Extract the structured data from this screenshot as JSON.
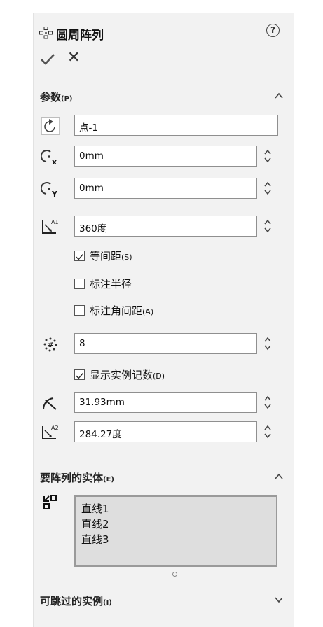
{
  "header": {
    "title": "圆周阵列",
    "help": "?"
  },
  "sections": {
    "params": {
      "label": "参数",
      "hotkey": "(P)",
      "axis_value": "点-1",
      "x_value": "0mm",
      "y_value": "0mm",
      "angle_value": "360度",
      "equal_spacing": {
        "label": "等间距",
        "hotkey": "(S)",
        "checked": true
      },
      "dim_radius": {
        "label": "标注半径",
        "checked": false
      },
      "dim_angle": {
        "label": "标注角间距",
        "hotkey": "(A)",
        "checked": false
      },
      "instances_value": "8",
      "show_count": {
        "label": "显示实例记数",
        "hotkey": "(D)",
        "checked": true
      },
      "radius_value": "31.93mm",
      "angle2_value": "284.27度"
    },
    "entities": {
      "label": "要阵列的实体",
      "hotkey": "(E)",
      "items": [
        "直线1",
        "直线2",
        "直线3"
      ]
    },
    "skip": {
      "label": "可跳过的实例",
      "hotkey": "(I)"
    }
  }
}
